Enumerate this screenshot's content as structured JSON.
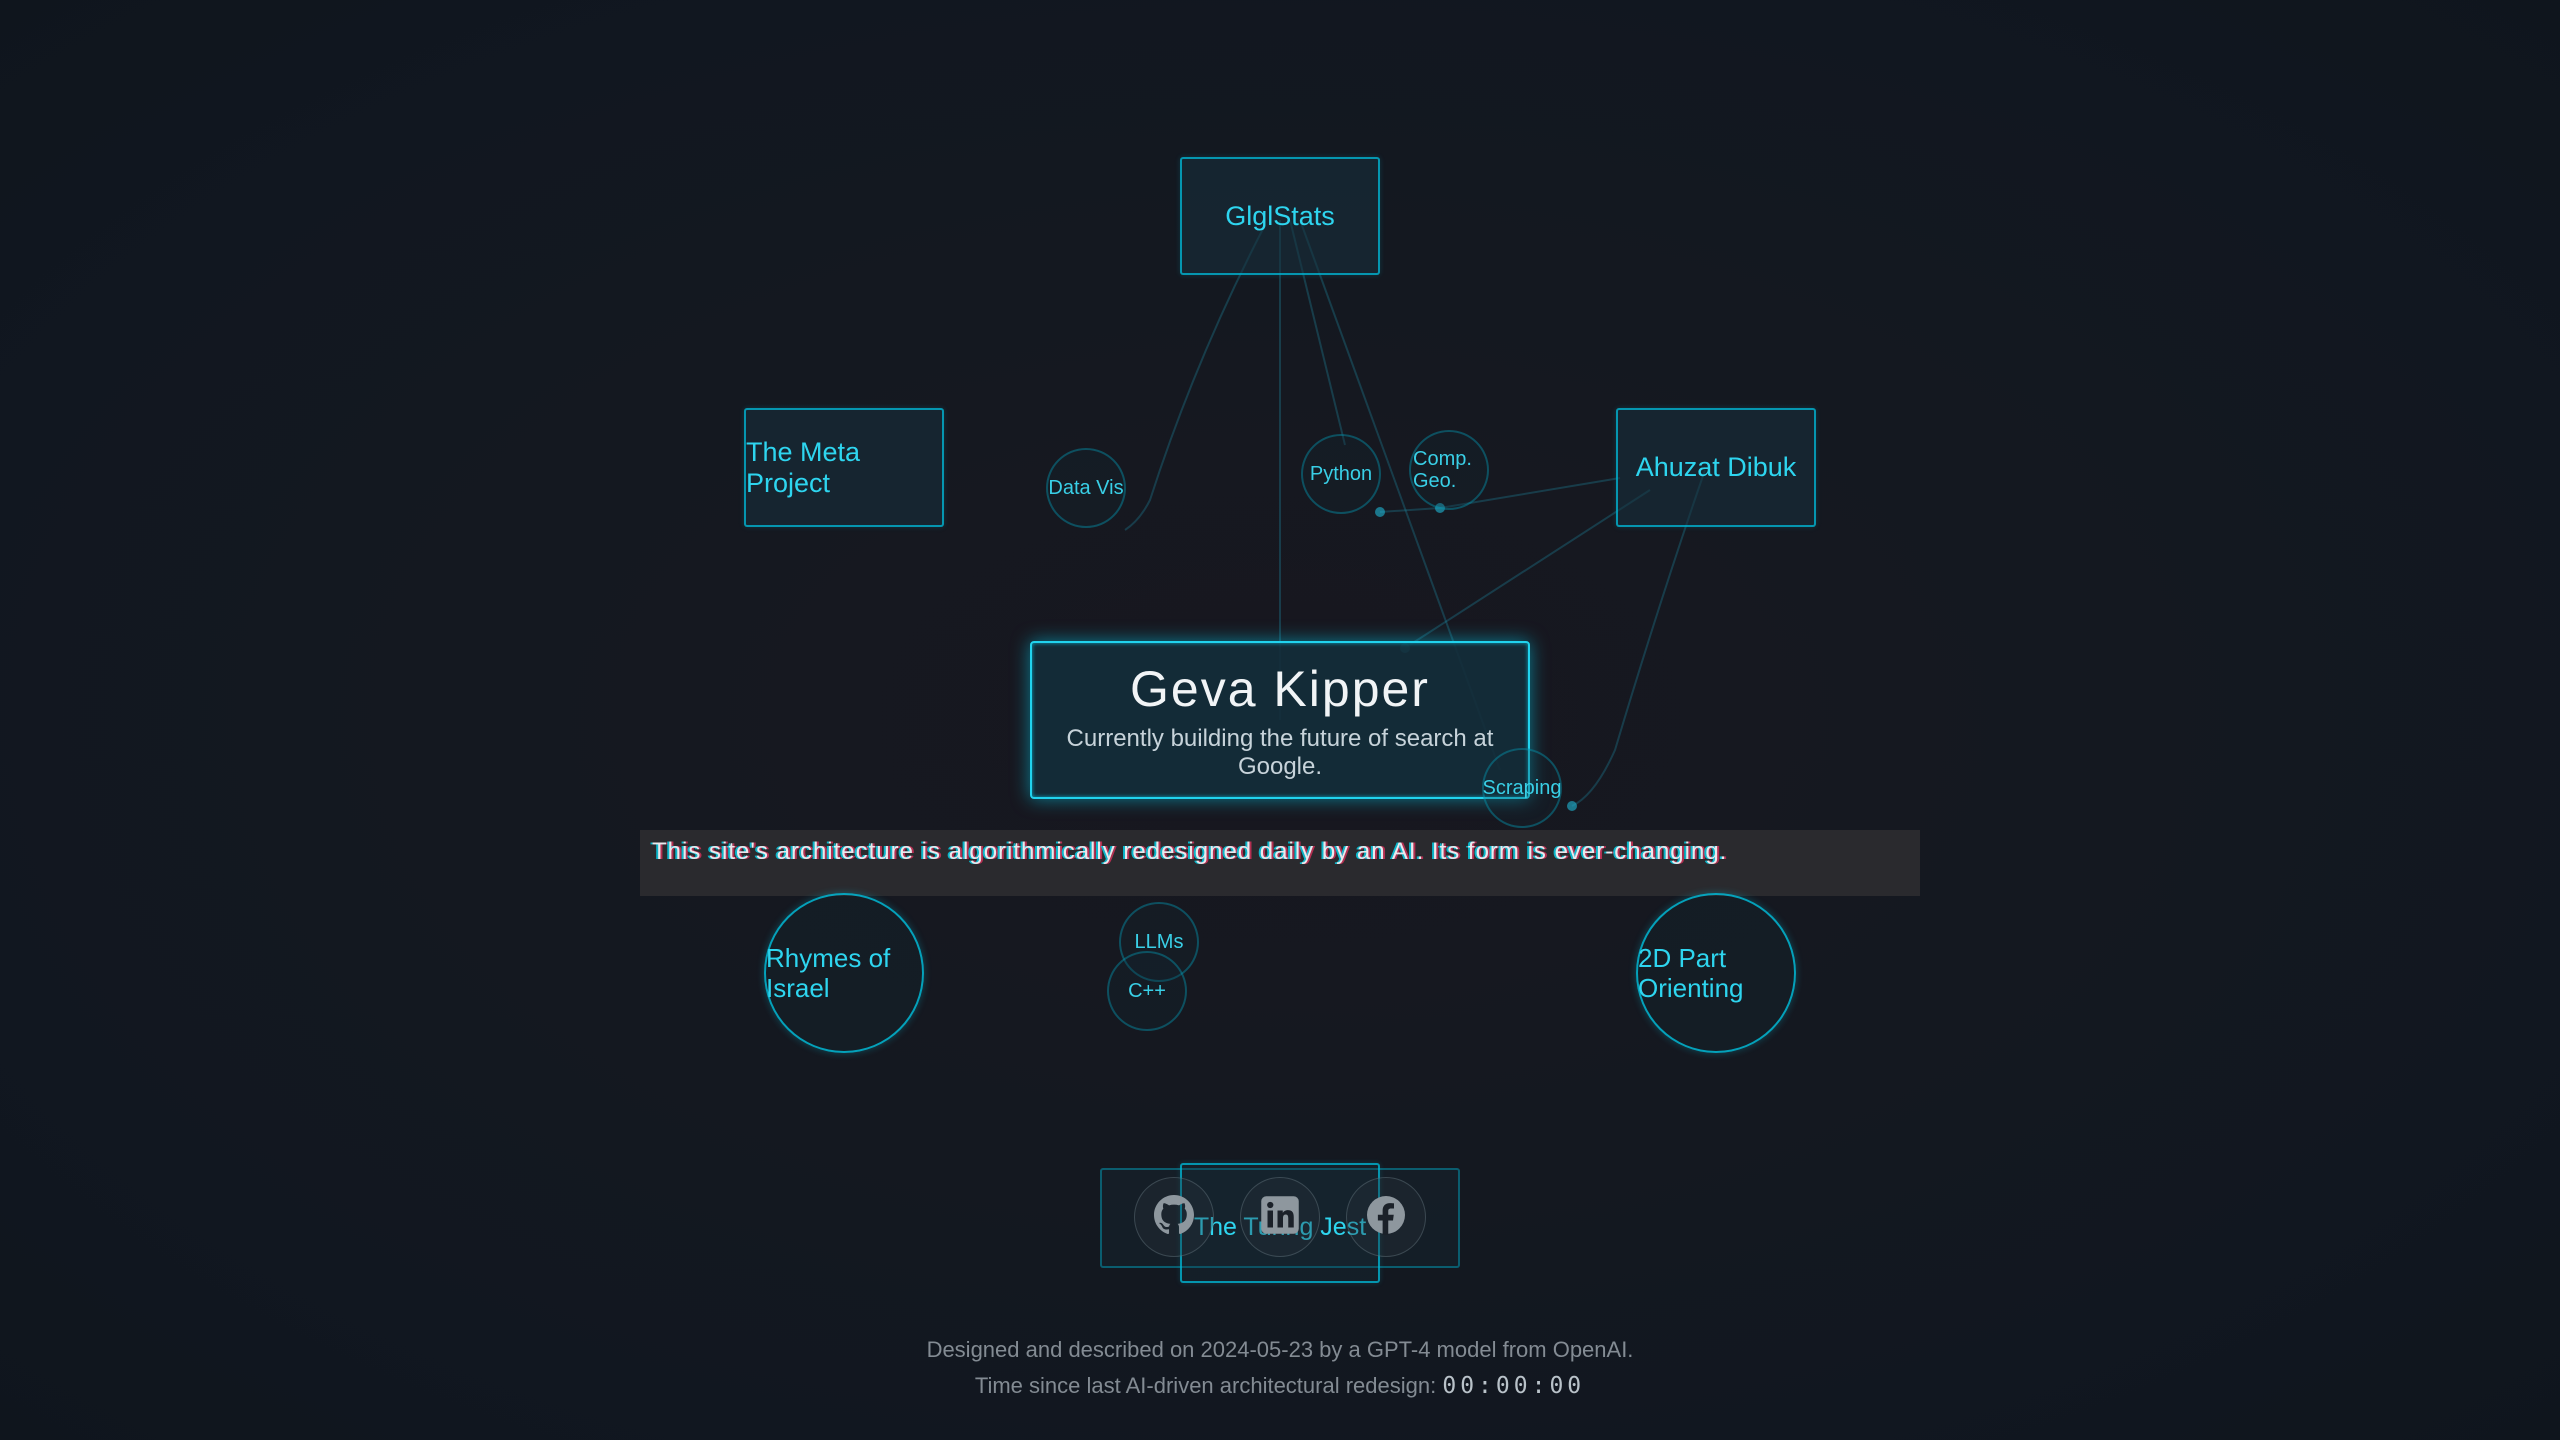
{
  "hero": {
    "name": "Geva Kipper",
    "tagline": "Currently building the future of search at Google."
  },
  "banner": {
    "text": "This site's architecture is algorithmically redesigned daily by an AI. Its form is ever-changing."
  },
  "projects": {
    "glglstats": "GlglStats",
    "meta_project": "The Meta Project",
    "ahuzat_dibuk": "Ahuzat Dibuk",
    "rhymes_of_israel": "Rhymes of Israel",
    "part_orienting": "2D Part Orienting",
    "turing_jest": "The Turing Jest"
  },
  "skills": {
    "data_vis": "Data Vis",
    "python": "Python",
    "comp_geo": "Comp. Geo.",
    "scraping": "Scraping",
    "llms": "LLMs",
    "cpp": "C++"
  },
  "social": {
    "github_icon": "github-icon",
    "linkedin_icon": "linkedin-icon",
    "facebook_icon": "facebook-icon"
  },
  "footer": {
    "designed": "Designed and described on 2024-05-23 by a GPT-4 model from OpenAI.",
    "redesign_label": "Time since last AI-driven architectural redesign:",
    "timer": "00:00:00"
  },
  "colors": {
    "background": "#111720",
    "accent": "#2ed5ef",
    "hero_border": "#21d3ee",
    "banner_bg": "#2c2c30",
    "footer_text": "#838b93"
  }
}
